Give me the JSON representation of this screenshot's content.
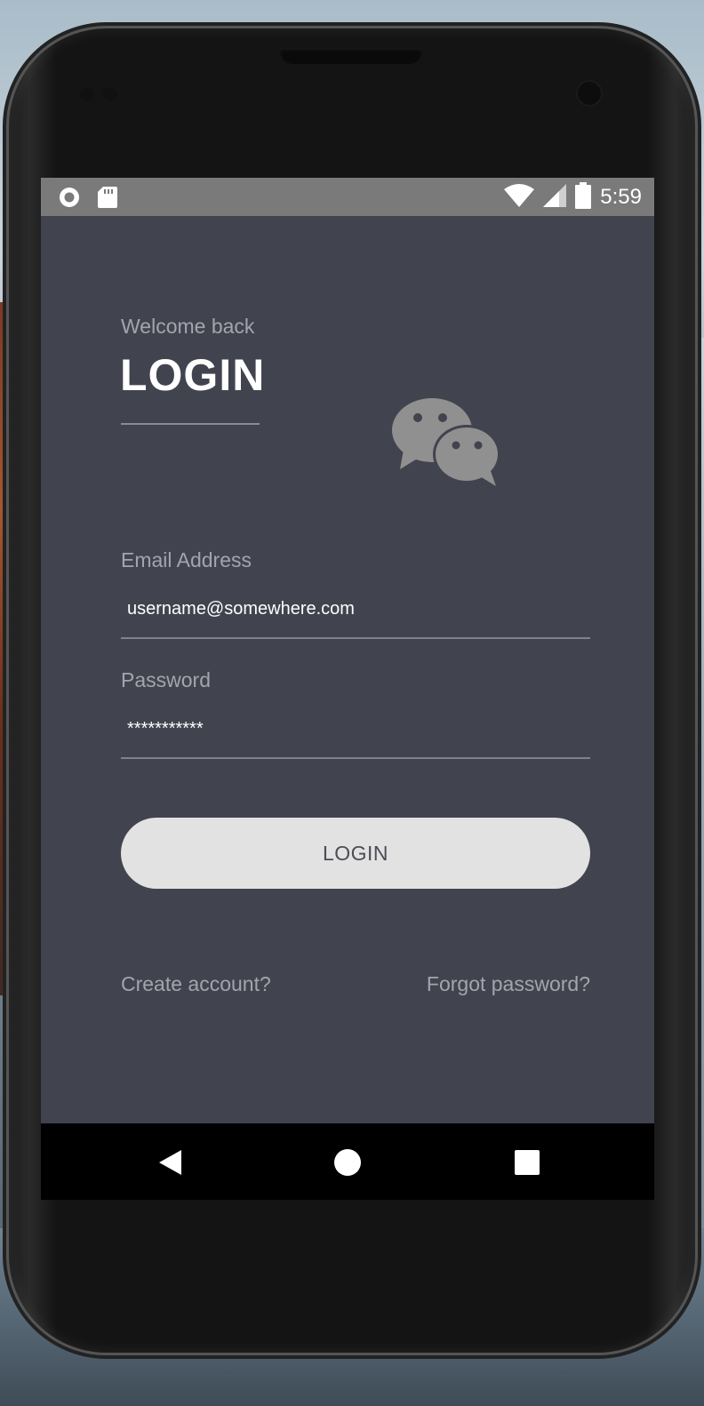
{
  "status_bar": {
    "time": "5:59",
    "left_icons": [
      "record-icon",
      "sd-card-icon"
    ],
    "right_icons": [
      "wifi-icon",
      "signal-icon",
      "battery-icon"
    ]
  },
  "login": {
    "welcome": "Welcome back",
    "title": "LOGIN",
    "logo_icon": "chat-bubbles-icon"
  },
  "email": {
    "label": "Email Address",
    "value": "username@somewhere.com"
  },
  "password": {
    "label": "Password",
    "value": "***********"
  },
  "button": {
    "label": "LOGIN"
  },
  "links": {
    "create": "Create account?",
    "forgot": "Forgot password?"
  },
  "nav": {
    "icons": [
      "back-icon",
      "home-icon",
      "recents-icon"
    ]
  },
  "colors": {
    "background": "#41434f",
    "status_bar": "#7a7a7a",
    "button": "#e2e2e2",
    "muted_text": "#a3a5ad"
  }
}
